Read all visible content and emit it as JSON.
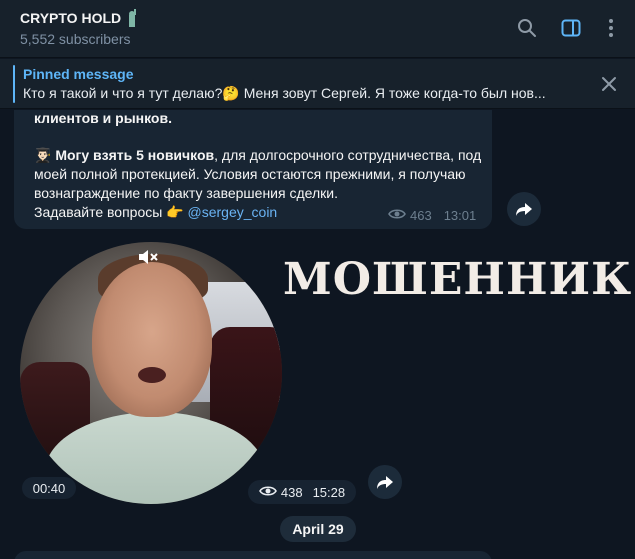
{
  "header": {
    "title": "CRYPTO HOLD",
    "title_icon": "statue-of-liberty-icon",
    "subscribers": "5,552 subscribers",
    "icons": [
      "search-icon",
      "sidebar-toggle-icon",
      "more-vert-icon"
    ]
  },
  "pinned": {
    "label": "Pinned message",
    "text": "Кто я такой и что я тут делаю?🤔  Меня зовут Сергей. Я тоже когда-то был нов..."
  },
  "message": {
    "line1": "клиентов и рынков.",
    "emoji": "👨🏻‍🎓",
    "bold_part": "Могу взять 5 новичков",
    "body_rest": ", для долгосрочного сотрудничества, под моей полной протекцией. Условия остаются прежними, я получаю вознаграждение по факту завершения сделки.",
    "question": "Задавайте вопросы 👉 ",
    "mention": "@sergey_coin",
    "views": "463",
    "time": "13:01"
  },
  "video": {
    "duration": "00:40",
    "views": "438",
    "time": "15:28"
  },
  "overlay_text": "МОШЕННИК",
  "date_separator": "April 29",
  "colors": {
    "background": "#0e1621",
    "header": "#17212b",
    "bubble": "#182533",
    "accent": "#5eb5f7",
    "meta": "#6d7f8f"
  }
}
